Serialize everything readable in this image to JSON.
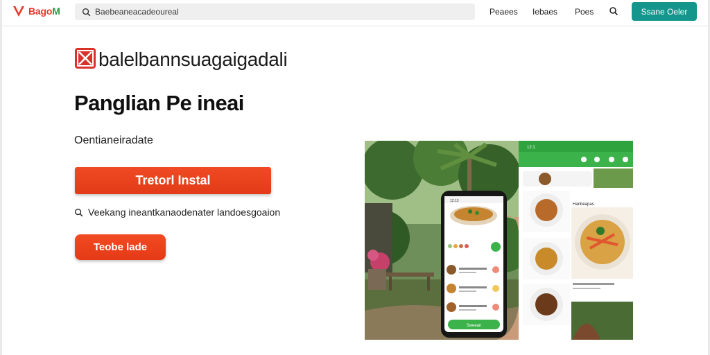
{
  "header": {
    "logo_text_red": "Bago",
    "logo_text_green": "M",
    "search_placeholder": "Baebeaneacadeoureal",
    "nav": [
      "Peaees",
      "Iebaes",
      "Poes"
    ],
    "cta_label": "Ssane Oeler"
  },
  "main": {
    "brand_title": "balelbannsuagaigadali",
    "headline": "Panglian Pe ineai",
    "subtext": "Oentianeiradate",
    "primary_button": "Tretorl Instal",
    "note": "Veekang ineantkanaodenater landoesgoaion",
    "secondary_button": "Teobe lade"
  },
  "hero": {
    "phone_status": "12:13",
    "phone_button": "Sweean",
    "tablet_status": "12:1",
    "section_label": "Hanbeapas",
    "colors": {
      "accent_red": "#e23b17",
      "accent_teal": "#14968c",
      "accent_green": "#3bb34a"
    }
  }
}
